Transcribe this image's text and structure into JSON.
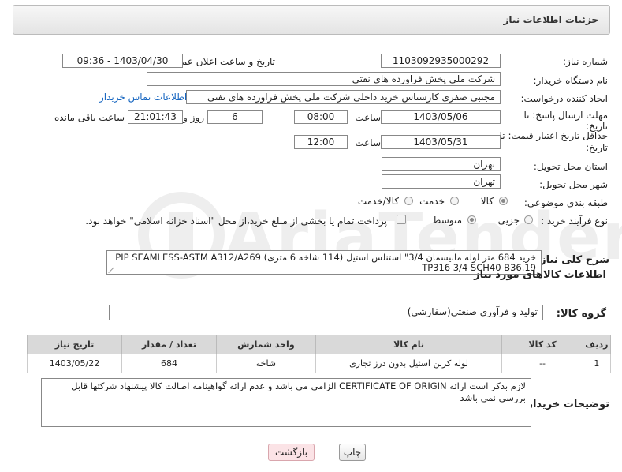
{
  "header": {
    "title": "جزئیات اطلاعات نیاز"
  },
  "fields": {
    "need_number_label": "شماره نیاز:",
    "need_number": "1103092935000292",
    "announce_label": "تاریخ و ساعت اعلان عمومی:",
    "announce_value": "1403/04/30 - 09:36",
    "buyer_org_label": "نام دستگاه خریدار:",
    "buyer_org": "شرکت ملی پخش فراورده های نفتی",
    "creator_label": "ایجاد کننده درخواست:",
    "creator": "مجتبی صفری کارشناس خرید داخلی شرکت ملی پخش فراورده های نفتی",
    "contact_link": "اطلاعات تماس خریدار",
    "deadline_label_1": "مهلت ارسال پاسخ: تا",
    "deadline_label_2": "تاریخ:",
    "deadline_date": "1403/05/06",
    "time_label": "ساعت",
    "deadline_time": "08:00",
    "days_value": "6",
    "days_label": "روز و",
    "remaining_time": "21:01:43",
    "remaining_label": "ساعت باقی مانده",
    "validity_label_1": "حداقل تاریخ اعتبار قیمت: تا",
    "validity_label_2": "تاریخ:",
    "validity_date": "1403/05/31",
    "validity_time_label": "ساعت",
    "validity_time": "12:00",
    "province_label": "استان محل تحویل:",
    "province": "تهران",
    "city_label": "شهر محل تحویل:",
    "city": "تهران",
    "category_label": "طبقه بندی موضوعی:",
    "category_options": [
      "کالا",
      "خدمت",
      "کالا/خدمت"
    ],
    "process_label": "نوع فرآیند خرید :",
    "process_options": [
      "جزیی",
      "متوسط"
    ],
    "payment_note": "پرداخت تمام یا بخشی از مبلغ خرید،از محل \"اسناد خزانه اسلامی\" خواهد بود."
  },
  "description": {
    "label": "شرح کلی نیاز:",
    "text": "خرید 684 متر لوله مانیسمان 3/4\" استنلس استیل (114 شاخه 6 متری) PIP SEAMLESS-ASTM A312/A269 TP316 3/4 SCH40 B36.19"
  },
  "goods_section": {
    "title": "اطلاعات کالاهای مورد نیاز",
    "group_label": "گروه کالا:",
    "group_value": "تولید و فرآوری صنعتی(سفارشی)"
  },
  "table": {
    "headers": [
      "ردیف",
      "کد کالا",
      "نام کالا",
      "واحد شمارش",
      "تعداد / مقدار",
      "تاریخ نیاز"
    ],
    "rows": [
      [
        "1",
        "--",
        "لوله کربن استیل بدون درز تجاری",
        "شاخه",
        "684",
        "1403/05/22"
      ]
    ]
  },
  "buyer_notes": {
    "label": "توضیحات خریدار:",
    "text": "لازم بذکر است ارائه CERTIFICATE OF ORIGIN  الزامی می باشد و عدم ارائه گواهینامه اصالت کالا پیشنهاد شرکتها قابل بررسی نمی باشد"
  },
  "buttons": {
    "print": "چاپ",
    "back": "بازگشت"
  },
  "watermark": {
    "text": "AriaTender.neT"
  }
}
